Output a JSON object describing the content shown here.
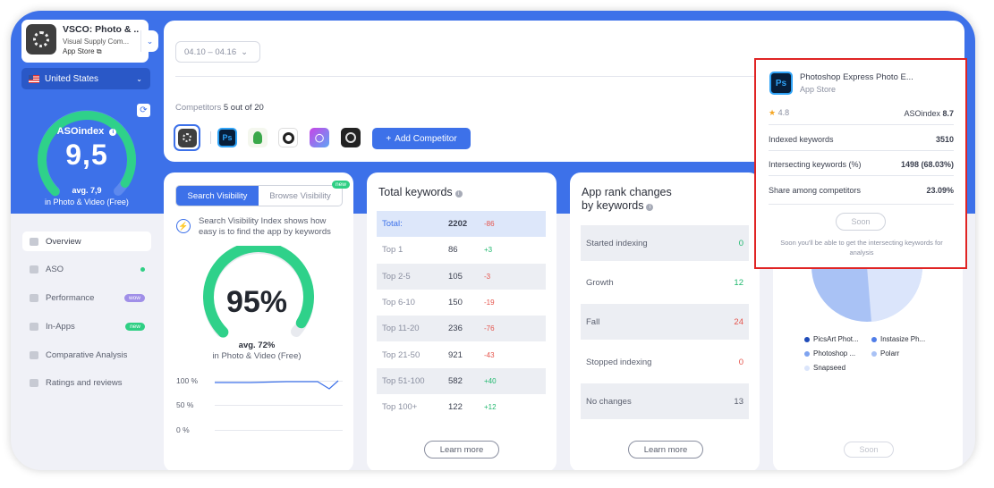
{
  "sidebar": {
    "app": {
      "name": "VSCO: Photo & ...",
      "developer": "Visual Supply Com...",
      "store": "App Store"
    },
    "country": "United States",
    "asoindex": {
      "label": "ASOindex",
      "value": "9,5",
      "avg": "avg. 7,9",
      "category": "in Photo & Video (Free)",
      "level": 0.95
    },
    "nav": [
      {
        "label": "Overview"
      },
      {
        "label": "ASO"
      },
      {
        "label": "Performance",
        "badge": "wow"
      },
      {
        "label": "In-Apps",
        "badge": "new"
      },
      {
        "label": "Comparative Analysis"
      },
      {
        "label": "Ratings and reviews"
      }
    ]
  },
  "header": {
    "date_range": "04.10 – 04.16",
    "competitors_label": "Competitors",
    "competitors_count": "5 out of 20",
    "add_competitor": "Add Competitor"
  },
  "search_visibility": {
    "tab_active": "Search Visibility",
    "tab_inactive": "Browse Visibility",
    "new_badge": "new",
    "description": "Search Visibility Index shows how easy is to find the app by keywords",
    "value": "95%",
    "level": 0.95,
    "avg": "avg. 72%",
    "category": "in Photo & Video (Free)",
    "y_ticks": [
      "100 %",
      "50 %",
      "0 %"
    ]
  },
  "total_keywords": {
    "title": "Total keywords",
    "rows": [
      {
        "label": "Total:",
        "value": "2202",
        "change": "-86"
      },
      {
        "label": "Top 1",
        "value": "86",
        "change": "+3"
      },
      {
        "label": "Top 2-5",
        "value": "105",
        "change": "-3"
      },
      {
        "label": "Top 6-10",
        "value": "150",
        "change": "-19"
      },
      {
        "label": "Top 11-20",
        "value": "236",
        "change": "-76"
      },
      {
        "label": "Top 21-50",
        "value": "921",
        "change": "-43"
      },
      {
        "label": "Top 51-100",
        "value": "582",
        "change": "+40"
      },
      {
        "label": "Top 100+",
        "value": "122",
        "change": "+12"
      }
    ],
    "learn_more": "Learn more"
  },
  "rank_changes": {
    "title": "App rank changes",
    "subtitle": "by keywords",
    "rows": [
      {
        "label": "Started indexing",
        "value": "0"
      },
      {
        "label": "Growth",
        "value": "12"
      },
      {
        "label": "Fall",
        "value": "24"
      },
      {
        "label": "Stopped indexing",
        "value": "0"
      },
      {
        "label": "No changes",
        "value": "13"
      }
    ],
    "learn_more": "Learn more"
  },
  "share_card": {
    "legend": [
      {
        "label": "PicsArt Phot...",
        "color": "#1f4bb8"
      },
      {
        "label": "Instasize Ph...",
        "color": "#4f7de8"
      },
      {
        "label": "Photoshop ...",
        "color": "#7ea3f0"
      },
      {
        "label": "Polarr",
        "color": "#a9c2f5"
      },
      {
        "label": "Snapseed",
        "color": "#dbe5fb"
      }
    ],
    "soon": "Soon"
  },
  "popup": {
    "app_name": "Photoshop Express Photo E...",
    "store": "App Store",
    "rating": "4.8",
    "asoindex_label": "ASOindex",
    "asoindex_value": "8.7",
    "rows": [
      {
        "label": "Indexed keywords",
        "value": "3510"
      },
      {
        "label": "Intersecting keywords (%)",
        "value": "1498 (68.03%)"
      },
      {
        "label": "Share among competitors",
        "value": "23.09%"
      }
    ],
    "soon": "Soon",
    "note": "Soon you'll be able to get the intersecting keywords for analysis"
  },
  "colors": {
    "accent": "#3d71e9",
    "gauge": "#2fd18a",
    "negative": "#e5534b",
    "positive": "#20b86e",
    "highlight_border": "#e02424"
  }
}
